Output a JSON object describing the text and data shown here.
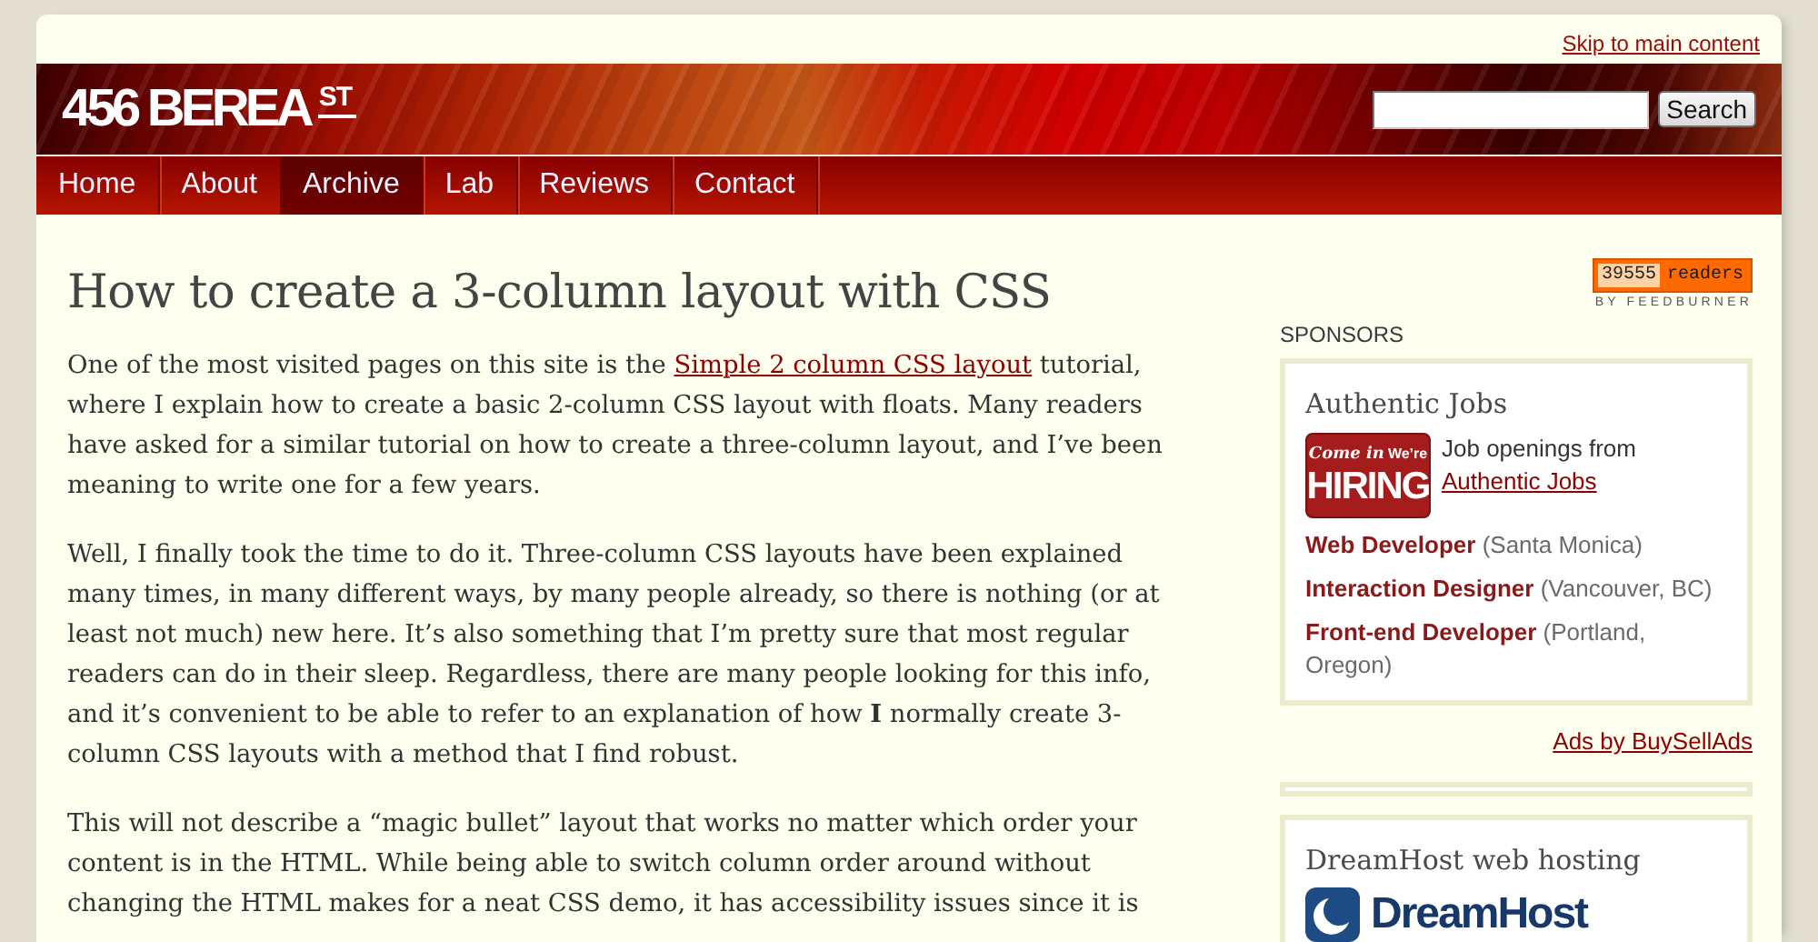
{
  "skip_link": "Skip to main content",
  "logo": {
    "name": "456 BEREA",
    "superscript": "ST"
  },
  "search": {
    "button": "Search"
  },
  "nav": [
    {
      "label": "Home",
      "selected": false
    },
    {
      "label": "About",
      "selected": false
    },
    {
      "label": "Archive",
      "selected": true
    },
    {
      "label": "Lab",
      "selected": false
    },
    {
      "label": "Reviews",
      "selected": false
    },
    {
      "label": "Contact",
      "selected": false
    }
  ],
  "article": {
    "title": "How to create a 3-column layout with CSS",
    "paragraphs": [
      {
        "runs": [
          {
            "kind": "text",
            "text": "One of the most visited pages on this site is the "
          },
          {
            "kind": "link",
            "text": "Simple 2 column CSS layout"
          },
          {
            "kind": "text",
            "text": " tutorial, where I explain how to create a basic 2-column CSS layout with floats. Many readers have asked for a similar tutorial on how to create a three-column layout, and I’ve been meaning to write one for a few years."
          }
        ]
      },
      {
        "runs": [
          {
            "kind": "text",
            "text": "Well, I finally took the time to do it. Three-column CSS layouts have been explained many times, in many different ways, by many people already, so there is nothing (or at least not much) new here. It’s also something that I’m pretty sure that most regular readers can do in their sleep. Regardless, there are many people looking for this info, and it’s convenient to be able to refer to an explanation of how **I** normally create 3-column CSS layouts with a method that I find robust."
          }
        ]
      },
      {
        "runs": [
          {
            "kind": "text",
            "text": "This will not describe a “magic bullet” layout that works no matter which order your content is in the HTML. While being able to switch column order around without changing the HTML makes for a neat CSS demo, it has accessibility issues since it is"
          }
        ]
      }
    ]
  },
  "sidebar": {
    "readers_badge": {
      "count": "39555",
      "label": "readers",
      "caption": "BY FEEDBURNER"
    },
    "sponsors_heading": "SPONSORS",
    "sponsor_box": {
      "title": "Authentic Jobs",
      "image": {
        "script": "Come in",
        "small": "We’re",
        "big": "HIRING"
      },
      "intro": "Job openings from",
      "intro_link": "Authentic Jobs",
      "jobs": [
        {
          "title": "Web Developer",
          "location": "(Santa Monica)"
        },
        {
          "title": "Interaction Designer",
          "location": "(Vancouver, BC)"
        },
        {
          "title": "Front-end Developer",
          "location": "(Portland, Oregon)"
        }
      ]
    },
    "ads_link": "Ads by BuySellAds",
    "hosting_box": {
      "title": "DreamHost web hosting",
      "logo_text": "DreamHost"
    }
  }
}
